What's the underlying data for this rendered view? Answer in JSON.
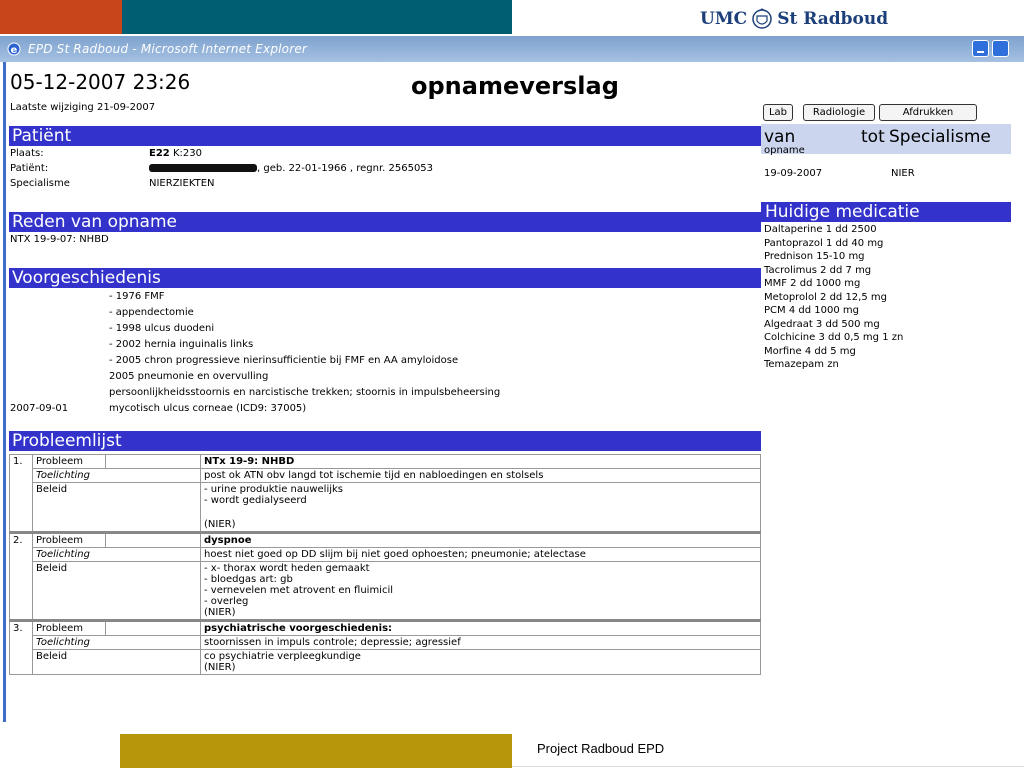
{
  "branding": {
    "logo_left": "UMC",
    "logo_right": "St Radboud",
    "footer": "Project Radboud EPD",
    "colors": {
      "red": "#c8451c",
      "teal": "#005e73",
      "gold": "#b8960c",
      "section_blue": "#3333cc"
    }
  },
  "window": {
    "title": "EPD St Radboud - Microsoft Internet Explorer",
    "icon": "ie-icon"
  },
  "report": {
    "datetime": "05-12-2007 23:26",
    "title": "opnameverslag",
    "last_modified": "Laatste wijziging 21-09-2007",
    "buttons": {
      "lab": "Lab",
      "radiology": "Radiologie",
      "print": "Afdrukken"
    }
  },
  "patient": {
    "heading": "Patiënt",
    "place_label": "Plaats:",
    "place_value_bold": "E22",
    "place_value": "K:230",
    "patient_label": "Patiënt:",
    "patient_value": ", geb. 22-01-1966 , regnr. 2565053",
    "specialism_label": "Specialisme",
    "specialism_value": "NIERZIEKTEN"
  },
  "admission": {
    "heading": "Reden van opname",
    "text": "NTX 19-9-07: NHBD"
  },
  "history": {
    "heading": "Voorgeschiedenis",
    "lines": [
      "- 1976 FMF",
      "- appendectomie",
      "- 1998 ulcus duodeni",
      "- 2002 hernia inguinalis links",
      "- 2005 chron progressieve nierinsufficientie bij FMF en AA amyloidose",
      "2005 pneumonie en overvulling",
      "persoonlijkheidsstoornis en narcistische trekken; stoornis in impulsbeheersing"
    ],
    "dated_date": "2007-09-01",
    "dated_text": "mycotisch ulcus corneae (ICD9: 37005)"
  },
  "stay": {
    "col_van": "van",
    "col_tot": "tot",
    "col_spec": "Specialisme",
    "sub": "opname",
    "date": "19-09-2007",
    "spec": "NIER"
  },
  "medication": {
    "heading": "Huidige medicatie",
    "items": [
      "Daltaperine 1 dd 2500",
      "Pantoprazol 1 dd 40 mg",
      "Prednison 15-10 mg",
      "Tacrolimus 2 dd 7 mg",
      "MMF 2 dd 1000 mg",
      "Metoprolol 2 dd 12,5 mg",
      "PCM 4 dd 1000 mg",
      "Algedraat 3 dd 500 mg",
      "Colchicine 3 dd 0,5 mg 1 zn",
      "Morfine 4 dd 5 mg",
      "Temazepam zn"
    ]
  },
  "problems": {
    "heading": "Probleemlijst",
    "label_problem": "Probleem",
    "label_explanation": "Toelichting",
    "label_policy": "Beleid",
    "items": [
      {
        "num": "1.",
        "problem": "NTx 19-9: NHBD",
        "explanation": "post ok ATN obv langd tot ischemie tijd en nabloedingen en stolsels",
        "policy": [
          "- urine produktie nauwelijks",
          "- wordt gedialyseerd",
          "",
          "(NIER)"
        ]
      },
      {
        "num": "2.",
        "problem": "dyspnoe",
        "explanation": "hoest niet goed op DD slijm bij niet goed ophoesten; pneumonie; atelectase",
        "policy": [
          "- x- thorax wordt heden gemaakt",
          "- bloedgas art: gb",
          "- vernevelen met atrovent en fluimicil",
          "- overleg",
          "(NIER)"
        ]
      },
      {
        "num": "3.",
        "problem": "psychiatrische voorgeschiedenis:",
        "explanation": "stoornissen in impuls controle; depressie; agressief",
        "policy": [
          "co psychiatrie verpleegkundige",
          "(NIER)"
        ]
      }
    ]
  }
}
